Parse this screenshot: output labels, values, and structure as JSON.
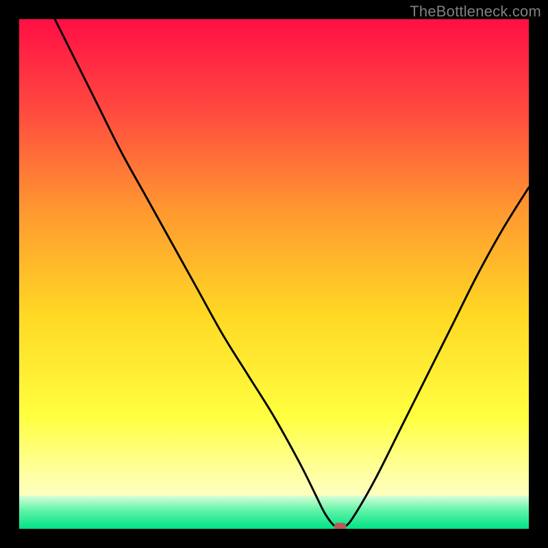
{
  "watermark": "TheBottleneck.com",
  "chart_data": {
    "type": "line",
    "title": "",
    "xlabel": "",
    "ylabel": "",
    "xlim": [
      0,
      100
    ],
    "ylim": [
      0,
      100
    ],
    "x": [
      7,
      10,
      15,
      20,
      25,
      30,
      35,
      40,
      45,
      50,
      55,
      58,
      60,
      62,
      64,
      66,
      70,
      75,
      80,
      85,
      90,
      95,
      100
    ],
    "values": [
      100,
      94,
      84,
      74,
      65,
      56,
      47,
      38,
      30,
      22,
      13,
      7,
      3,
      0.5,
      0.5,
      3,
      10,
      20,
      30,
      40,
      50,
      59,
      67
    ],
    "marker": {
      "x": 63,
      "y": 0.5
    },
    "green_band_top": 6.5,
    "colors": {
      "gradient_top": "#ff0f45",
      "gradient_mid_upper": "#ff6a3b",
      "gradient_mid": "#ffdb24",
      "gradient_lower": "#ffff66",
      "gradient_pale": "#fdffcf",
      "gradient_green": "#00e386",
      "curve": "#000000",
      "marker": "#b85a57",
      "frame_bg": "#000000"
    }
  }
}
